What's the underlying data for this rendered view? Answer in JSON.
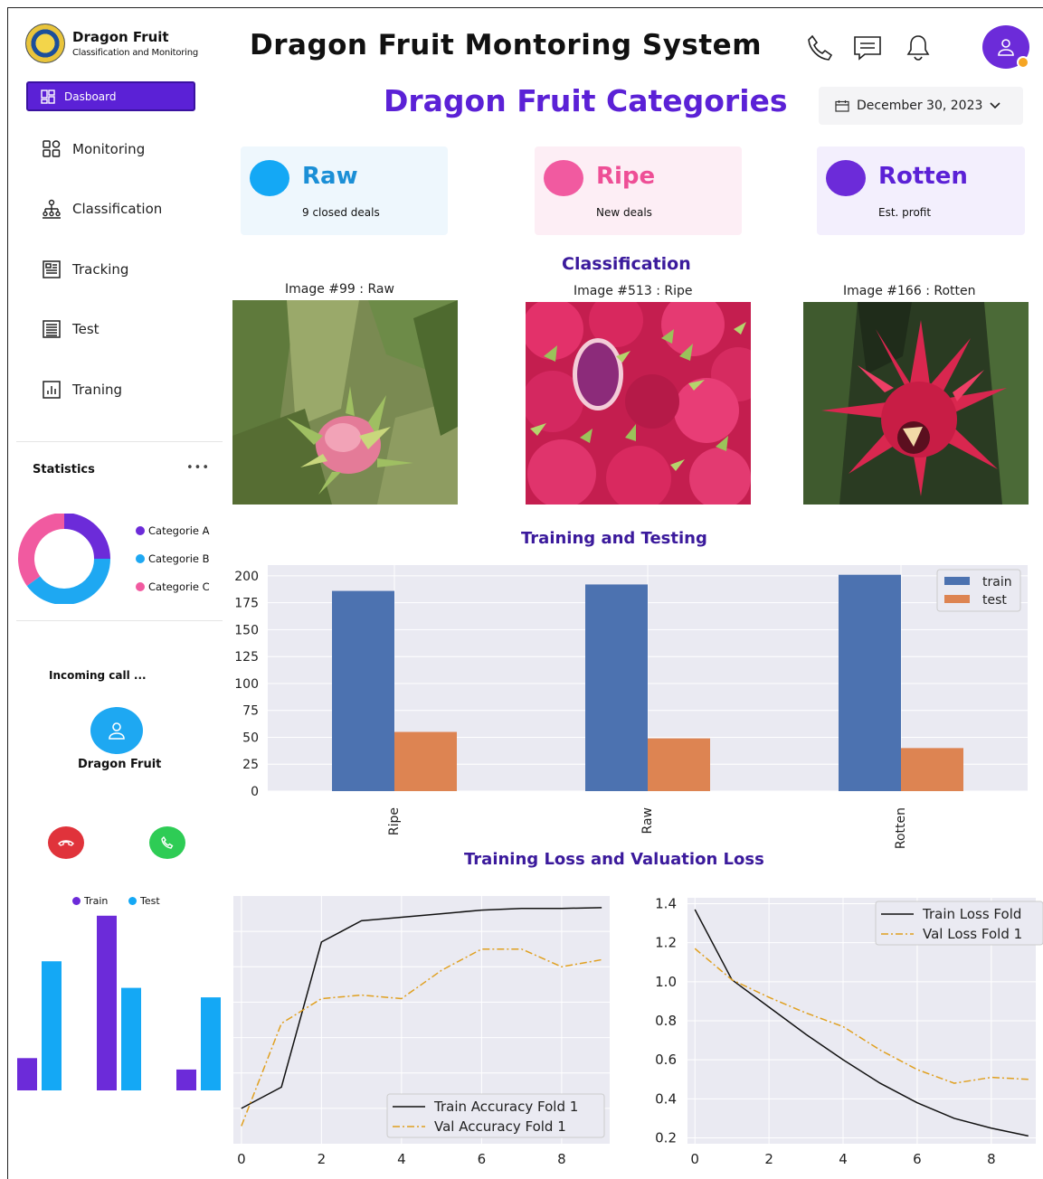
{
  "sidebar": {
    "brand_title": "Dragon Fruit",
    "brand_sub": "Classification and Monitoring",
    "dashboard_label": "Dasboard",
    "nav": [
      {
        "label": "Monitoring",
        "icon": "grid-icon"
      },
      {
        "label": "Classification",
        "icon": "hierarchy-icon"
      },
      {
        "label": "Tracking",
        "icon": "newspaper-icon"
      },
      {
        "label": "Test",
        "icon": "list-icon"
      },
      {
        "label": "Traning",
        "icon": "bar-chart-icon"
      }
    ],
    "statistics": {
      "title": "Statistics",
      "more": "•••",
      "legend": [
        "Categorie A",
        "Categorie B",
        "Categorie C"
      ],
      "values": [
        25,
        40,
        35
      ],
      "colors": [
        "#6c2bd9",
        "#1ea8f2",
        "#f15aa0"
      ]
    },
    "call": {
      "status": "Incoming call ...",
      "caller": "Dragon Fruit"
    },
    "mini_chart": {
      "legend": [
        "Train",
        "Test"
      ],
      "colors": [
        "#6c2bd9",
        "#14a8f5"
      ],
      "groups": [
        {
          "train": 0.17,
          "test": 0.68
        },
        {
          "train": 0.92,
          "test": 0.54
        },
        {
          "train": 0.11,
          "test": 0.49
        }
      ]
    }
  },
  "header": {
    "title": "Dragon Fruit Montoring System",
    "page_title": "Dragon Fruit Categories",
    "date": "December 30, 2023"
  },
  "cards": [
    {
      "label": "Raw",
      "sub": "9 closed deals",
      "color": "#14a8f5",
      "text_color": "#1b8fd6",
      "bg": "#eef7fd"
    },
    {
      "label": "Ripe",
      "sub": "New deals",
      "color": "#f15aa0",
      "text_color": "#ee4f96",
      "bg": "#fdeef5"
    },
    {
      "label": "Rotten",
      "sub": "Est. profit",
      "color": "#6c2bd9",
      "text_color": "#5b21d6",
      "bg": "#f3effd"
    }
  ],
  "classification": {
    "title": "Classification",
    "images": [
      {
        "caption": "Image #99 : Raw"
      },
      {
        "caption": "Image #513 : Ripe"
      },
      {
        "caption": "Image #166 : Rotten"
      }
    ]
  },
  "training_testing": {
    "title": "Training and Testing"
  },
  "loss_section": {
    "title": "Training Loss and Valuation Loss"
  },
  "chart_data": [
    {
      "type": "bar",
      "categories": [
        "Ripe",
        "Raw",
        "Rotten"
      ],
      "series": [
        {
          "name": "train",
          "values": [
            186,
            192,
            201
          ],
          "color": "#4c72b0"
        },
        {
          "name": "test",
          "values": [
            55,
            49,
            40
          ],
          "color": "#dd8452"
        }
      ],
      "ylim": [
        0,
        210
      ],
      "yticks": [
        0,
        25,
        50,
        75,
        100,
        125,
        150,
        175,
        200
      ],
      "legend": "top-right",
      "grid": true
    },
    {
      "type": "line",
      "x": [
        0,
        1,
        2,
        3,
        4,
        5,
        6,
        7,
        8,
        9
      ],
      "series": [
        {
          "name": "Train Accuracy Fold 1",
          "values": [
            0.3,
            0.36,
            0.77,
            0.83,
            0.84,
            0.85,
            0.86,
            0.865,
            0.865,
            0.867
          ],
          "color": "#111111",
          "dash": "solid"
        },
        {
          "name": "Val Accuracy Fold 1",
          "values": [
            0.25,
            0.54,
            0.61,
            0.62,
            0.61,
            0.69,
            0.75,
            0.75,
            0.7,
            0.72
          ],
          "color": "#e0a020",
          "dash": "dashdot"
        }
      ],
      "xticks": [
        0,
        2,
        4,
        6,
        8
      ],
      "ylim": [
        0.2,
        0.9
      ],
      "legend": "bottom-right",
      "grid": true
    },
    {
      "type": "line",
      "x": [
        0,
        1,
        2,
        3,
        4,
        5,
        6,
        7,
        8,
        9
      ],
      "series": [
        {
          "name": "Train Loss Fold",
          "values": [
            1.37,
            1.01,
            0.87,
            0.73,
            0.6,
            0.48,
            0.38,
            0.3,
            0.25,
            0.21
          ],
          "color": "#111111",
          "dash": "solid"
        },
        {
          "name": "Val Loss Fold 1",
          "values": [
            1.17,
            1.01,
            0.92,
            0.84,
            0.77,
            0.65,
            0.55,
            0.48,
            0.51,
            0.5
          ],
          "color": "#e0a020",
          "dash": "dashdot"
        }
      ],
      "xticks": [
        0,
        2,
        4,
        6,
        8
      ],
      "yticks": [
        0.2,
        0.4,
        0.6,
        0.8,
        1.0,
        1.2,
        1.4
      ],
      "ylim": [
        0.17,
        1.43
      ],
      "legend": "top-right",
      "grid": true
    }
  ]
}
